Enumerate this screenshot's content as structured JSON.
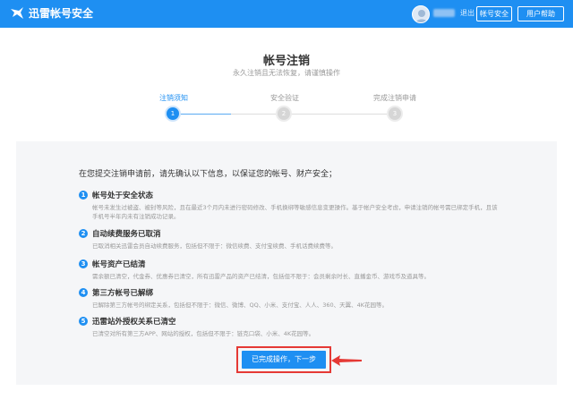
{
  "header": {
    "logo_text": "迅雷帐号安全",
    "logout": "退出",
    "account_security": "帐号安全",
    "user_help": "用户帮助"
  },
  "page": {
    "title": "帐号注销",
    "subtitle": "永久注销且无法恢复，请谨慎操作"
  },
  "steps": [
    {
      "label": "注销须知",
      "num": "1"
    },
    {
      "label": "安全验证",
      "num": "2"
    },
    {
      "label": "完成注销申请",
      "num": "3"
    }
  ],
  "intro": "在您提交注销申请前，请先确认以下信息，以保证您的帐号、财产安全；",
  "items": [
    {
      "num": "1",
      "title": "帐号处于安全状态",
      "desc": "帐号未发生过被盗、被封等风险，且在最近3个月内未进行密码修改、手机换绑等敏感信息变更操作。基于帐户安全考虑，申请注销的帐号需已绑定手机，且该手机号半年内未有注销成功记录。"
    },
    {
      "num": "2",
      "title": "自动续费服务已取消",
      "desc": "已取消相关迅雷会员自动续费服务，包括但不限于：微信续费、支付宝续费、手机话费续费等。"
    },
    {
      "num": "3",
      "title": "帐号资产已结清",
      "desc": "需余额已清空，代金券、优惠券已清空，所有迅雷产品的资产已结清，包括但不限于：会员剩余时长、直播金币、游戏币及道具等。"
    },
    {
      "num": "4",
      "title": "第三方帐号已解绑",
      "desc": "已解除第三方帐号的绑定关系，包括但不限于：微信、微博、QQ、小米、支付宝、人人、360、天翼、4K花园等。"
    },
    {
      "num": "5",
      "title": "迅雷站外授权关系已清空",
      "desc": "已清空对所有第三方APP、网站的授权，包括但不限于：链克口袋、小米、4K花园等。"
    }
  ],
  "next_button": "已完成操作，下一步",
  "colors": {
    "brand": "#1e8ff2",
    "highlight": "#e53935",
    "panel": "#f5f6f8"
  },
  "icons": {
    "logo": "xunlei-bird-icon",
    "avatar": "user-avatar",
    "arrow": "red-arrow-icon"
  }
}
